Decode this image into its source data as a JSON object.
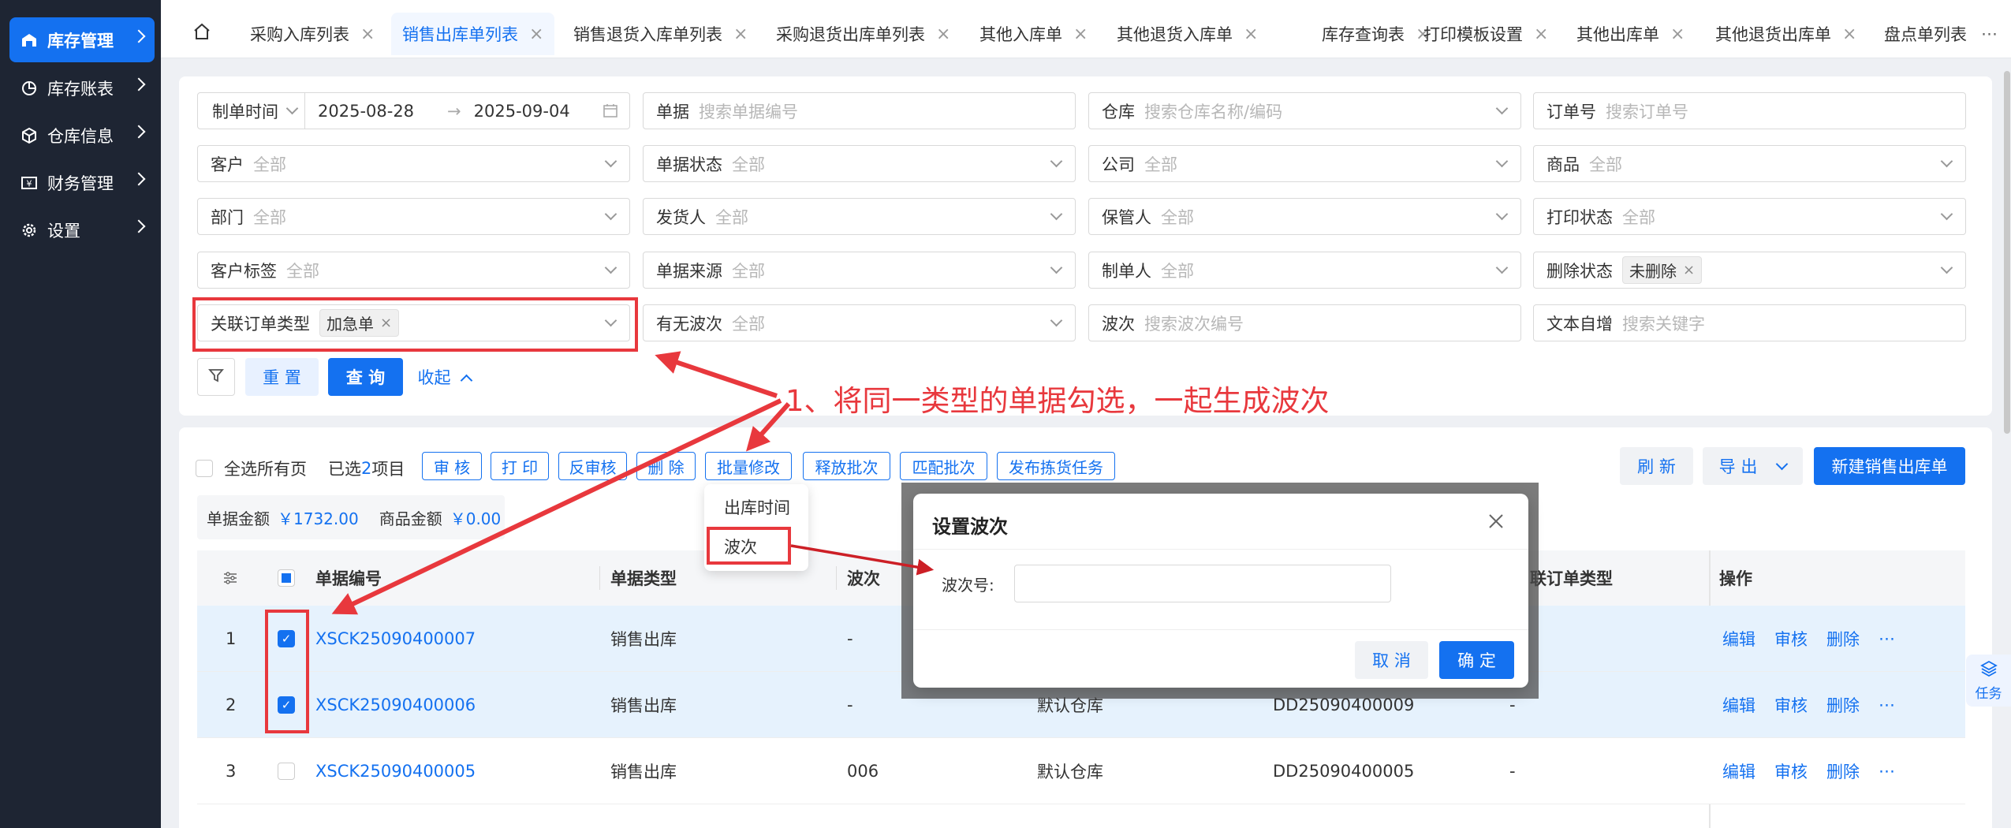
{
  "sidebar": {
    "items": [
      {
        "label": "库存管理",
        "icon": "warehouse-icon",
        "active": true
      },
      {
        "label": "库存账表",
        "icon": "pie-chart-icon"
      },
      {
        "label": "仓库信息",
        "icon": "cube-icon"
      },
      {
        "label": "财务管理",
        "icon": "finance-icon"
      },
      {
        "label": "设置",
        "icon": "gear-icon"
      }
    ]
  },
  "tabs": {
    "home_icon": "home-icon",
    "items": [
      "采购入库列表",
      "销售出库单列表",
      "销售退货入库单列表",
      "采购退货出库单列表",
      "其他入库单",
      "其他退货入库单",
      "库存查询表",
      "打印模板设置",
      "其他出库单",
      "其他退货出库单",
      "盘点单列表"
    ],
    "active_index": 1,
    "more": "⋯"
  },
  "filters": {
    "date": {
      "label": "制单时间",
      "start": "2025-08-28",
      "end": "2025-09-04",
      "sep": "→"
    },
    "doc": {
      "label": "单据",
      "placeholder": "搜索单据编号"
    },
    "warehouse": {
      "label": "仓库",
      "placeholder": "搜索仓库名称/编码"
    },
    "order_no": {
      "label": "订单号",
      "placeholder": "搜索订单号"
    },
    "customer": {
      "label": "客户",
      "placeholder": "全部"
    },
    "doc_status": {
      "label": "单据状态",
      "placeholder": "全部"
    },
    "company": {
      "label": "公司",
      "placeholder": "全部"
    },
    "goods": {
      "label": "商品",
      "placeholder": "全部"
    },
    "dept": {
      "label": "部门",
      "placeholder": "全部"
    },
    "shipper": {
      "label": "发货人",
      "placeholder": "全部"
    },
    "keeper": {
      "label": "保管人",
      "placeholder": "全部"
    },
    "print_status": {
      "label": "打印状态",
      "placeholder": "全部"
    },
    "customer_tag": {
      "label": "客户标签",
      "placeholder": "全部"
    },
    "doc_source": {
      "label": "单据来源",
      "placeholder": "全部"
    },
    "creator": {
      "label": "制单人",
      "placeholder": "全部"
    },
    "delete_status": {
      "label": "删除状态",
      "tag": "未删除"
    },
    "order_type": {
      "label": "关联订单类型",
      "tag": "加急单"
    },
    "has_batch": {
      "label": "有无波次",
      "placeholder": "全部"
    },
    "batch": {
      "label": "波次",
      "placeholder": "搜索波次编号"
    },
    "text": {
      "label": "文本自增",
      "placeholder": "搜索关键字"
    }
  },
  "filter_actions": {
    "reset": "重 置",
    "query": "查 询",
    "collapse": "收起"
  },
  "annotation": "1、将同一类型的单据勾选，一起生成波次",
  "toolbar": {
    "select_all": "全选所有页",
    "selected_prefix": "已选",
    "selected_count": "2",
    "selected_suffix": "项目",
    "buttons": [
      "审 核",
      "打 印",
      "反审核",
      "删 除",
      "批量修改",
      "释放批次",
      "匹配批次",
      "发布拣货任务"
    ],
    "refresh": "刷 新",
    "export": "导 出",
    "new": "新建销售出库单"
  },
  "summary": {
    "doc_amount_label": "单据金额",
    "doc_amount": "￥1732.00",
    "goods_amount_label": "商品金额",
    "goods_amount": "￥0.00"
  },
  "dropdown": {
    "items": [
      "出库时间",
      "波次"
    ]
  },
  "dialog": {
    "title": "设置波次",
    "field_label": "波次号:",
    "cancel": "取 消",
    "ok": "确 定"
  },
  "table": {
    "headers": [
      "单据编号",
      "单据类型",
      "波次",
      "联订单类型",
      "操作"
    ],
    "rows": [
      {
        "idx": "1",
        "checked": true,
        "doc_no": "XSCK25090400007",
        "type": "销售出库",
        "batch": "-",
        "warehouse": "",
        "order_no": "",
        "order_type": "",
        "ops": [
          "编辑",
          "审核",
          "删除",
          "⋯"
        ]
      },
      {
        "idx": "2",
        "checked": true,
        "doc_no": "XSCK25090400006",
        "type": "销售出库",
        "batch": "-",
        "warehouse": "默认仓库",
        "order_no": "DD25090400009",
        "order_type": "-",
        "ops": [
          "编辑",
          "审核",
          "删除",
          "⋯"
        ]
      },
      {
        "idx": "3",
        "checked": false,
        "doc_no": "XSCK25090400005",
        "type": "销售出库",
        "batch": "006",
        "warehouse": "默认仓库",
        "order_no": "DD25090400005",
        "order_type": "-",
        "ops": [
          "编辑",
          "审核",
          "删除",
          "⋯"
        ]
      }
    ]
  },
  "float_task": {
    "label": "任务",
    "icon": "layers-icon"
  },
  "colors": {
    "primary": "#1471f0",
    "sidebar": "#1e2533",
    "annotation": "#e8383d",
    "selected_row": "#e6f2fd"
  }
}
